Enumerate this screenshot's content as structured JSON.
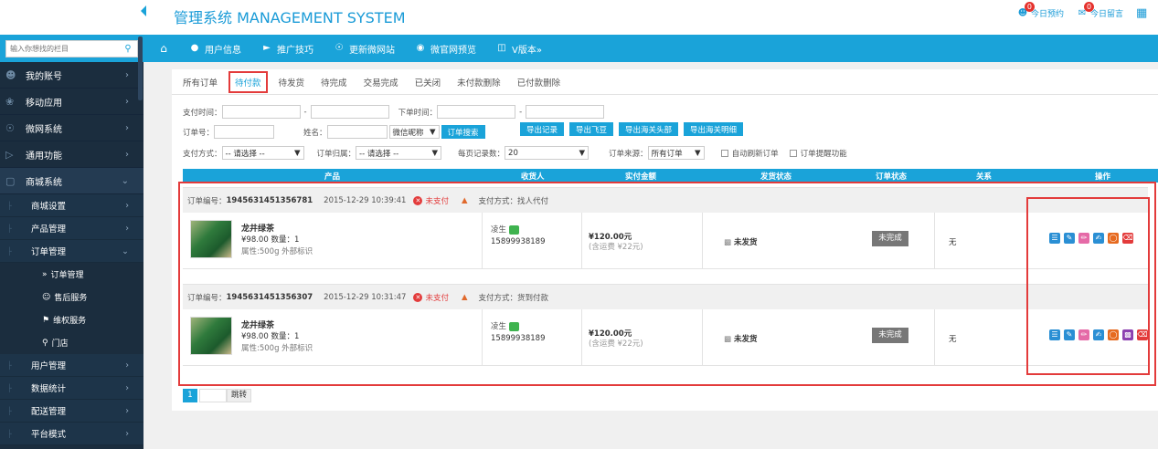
{
  "header": {
    "title": "管理系统 MANAGEMENT SYSTEM",
    "right_items": [
      {
        "icon": "user-icon",
        "label": "今日预约",
        "badge": "0"
      },
      {
        "icon": "message-icon",
        "label": "今日留言",
        "badge": "0"
      },
      {
        "icon": "qrcode-icon",
        "label": ""
      }
    ]
  },
  "sidebar": {
    "search_placeholder": "输入你想找的栏目",
    "items": [
      {
        "icon": "user-icon",
        "label": "我的账号"
      },
      {
        "icon": "apps-icon",
        "label": "移动应用"
      },
      {
        "icon": "globe-icon",
        "label": "微网系统"
      },
      {
        "icon": "function-icon",
        "label": "通用功能"
      },
      {
        "icon": "cart-icon",
        "label": "商城系统"
      }
    ],
    "mall_sub": [
      {
        "label": "商城设置"
      },
      {
        "label": "产品管理"
      },
      {
        "label": "订单管理"
      }
    ],
    "order_sub": [
      {
        "label": "订单管理",
        "prefix": "»"
      },
      {
        "label": "售后服务"
      },
      {
        "label": "维权服务"
      },
      {
        "label": "门店"
      }
    ],
    "more_sub": [
      {
        "label": "用户管理"
      },
      {
        "label": "数据统计"
      },
      {
        "label": "配送管理"
      },
      {
        "label": "平台模式"
      }
    ]
  },
  "navbar": {
    "items": [
      {
        "icon": "home-icon",
        "label": ""
      },
      {
        "icon": "user-icon",
        "label": "用户信息"
      },
      {
        "icon": "megaphone-icon",
        "label": "推广技巧"
      },
      {
        "icon": "globe-icon",
        "label": "更新微网站"
      },
      {
        "icon": "eye-icon",
        "label": "微官网预览"
      },
      {
        "icon": "version-icon",
        "label": "V版本»"
      }
    ]
  },
  "tabs": [
    "所有订单",
    "待付款",
    "待发货",
    "待完成",
    "交易完成",
    "已关闭",
    "未付款删除",
    "已付款删除"
  ],
  "active_tab": 1,
  "filters": {
    "pay_time_label": "支付时间：",
    "ship_time_label": "下单时间：",
    "dash": "-",
    "order_no_label": "订单号：",
    "name_label": "姓名：",
    "nickname_select": "微信昵称",
    "search_btn": "订单搜索",
    "export_buttons": [
      "导出记录",
      "导出飞豆",
      "导出海关头部",
      "导出海关明细"
    ],
    "pay_method_label": "支付方式：",
    "pay_method_value": "-- 请选择 --",
    "order_category_label": "订单归属：",
    "order_category_value": "-- 请选择 --",
    "per_page_label": "每页记录数：",
    "per_page_value": "20",
    "source_label": "订单来源：",
    "source_value": "所有订单",
    "auto_refresh": "自动刷新订单",
    "remind": "订单提醒功能"
  },
  "table": {
    "headers": [
      "产品",
      "收货人",
      "实付金额",
      "发货状态",
      "订单状态",
      "关系",
      "操作"
    ]
  },
  "orders": [
    {
      "no_label": "订单编号：",
      "no": "1945631451356781",
      "time": "2015-12-29 10:39:41",
      "status": "未支付",
      "pay": "支付方式：找人代付",
      "product": "龙井绿茶",
      "price_qty": "¥98.00 数量：1",
      "attr": "属性:500g 外部标识",
      "buyer": "凌生",
      "phone": "15899938189",
      "amount": "¥120.00元",
      "fee": "(含运费 ¥22元)",
      "ship": "未发货",
      "order_status": "未完成",
      "relation": "无",
      "ops": [
        {
          "icon": "note-icon",
          "color": "#2a8fd4"
        },
        {
          "icon": "edit-box-icon",
          "color": "#2a8fd4"
        },
        {
          "icon": "pencil-icon",
          "color": "#e56aa7"
        },
        {
          "icon": "pen-icon",
          "color": "#2a8fd4"
        },
        {
          "icon": "search-circle-icon",
          "color": "#e66a20"
        },
        {
          "icon": "trash-icon",
          "color": "#e33b3b"
        }
      ]
    },
    {
      "no_label": "订单编号：",
      "no": "1945631451356307",
      "time": "2015-12-29 10:31:47",
      "status": "未支付",
      "pay": "支付方式：货到付款",
      "product": "龙井绿茶",
      "price_qty": "¥98.00 数量：1",
      "attr": "属性:500g 外部标识",
      "buyer": "凌生",
      "phone": "15899938189",
      "amount": "¥120.00元",
      "fee": "(含运费 ¥22元)",
      "ship": "未发货",
      "order_status": "未完成",
      "relation": "无",
      "ops": [
        {
          "icon": "note-icon",
          "color": "#2a8fd4"
        },
        {
          "icon": "edit-box-icon",
          "color": "#2a8fd4"
        },
        {
          "icon": "pencil-icon",
          "color": "#e56aa7"
        },
        {
          "icon": "pen-icon",
          "color": "#2a8fd4"
        },
        {
          "icon": "search-circle-icon",
          "color": "#e66a20"
        },
        {
          "icon": "truck-icon",
          "color": "#8b3fb0"
        },
        {
          "icon": "trash-icon",
          "color": "#e33b3b"
        }
      ]
    }
  ],
  "pager": {
    "current": "1",
    "go": "跳转"
  }
}
